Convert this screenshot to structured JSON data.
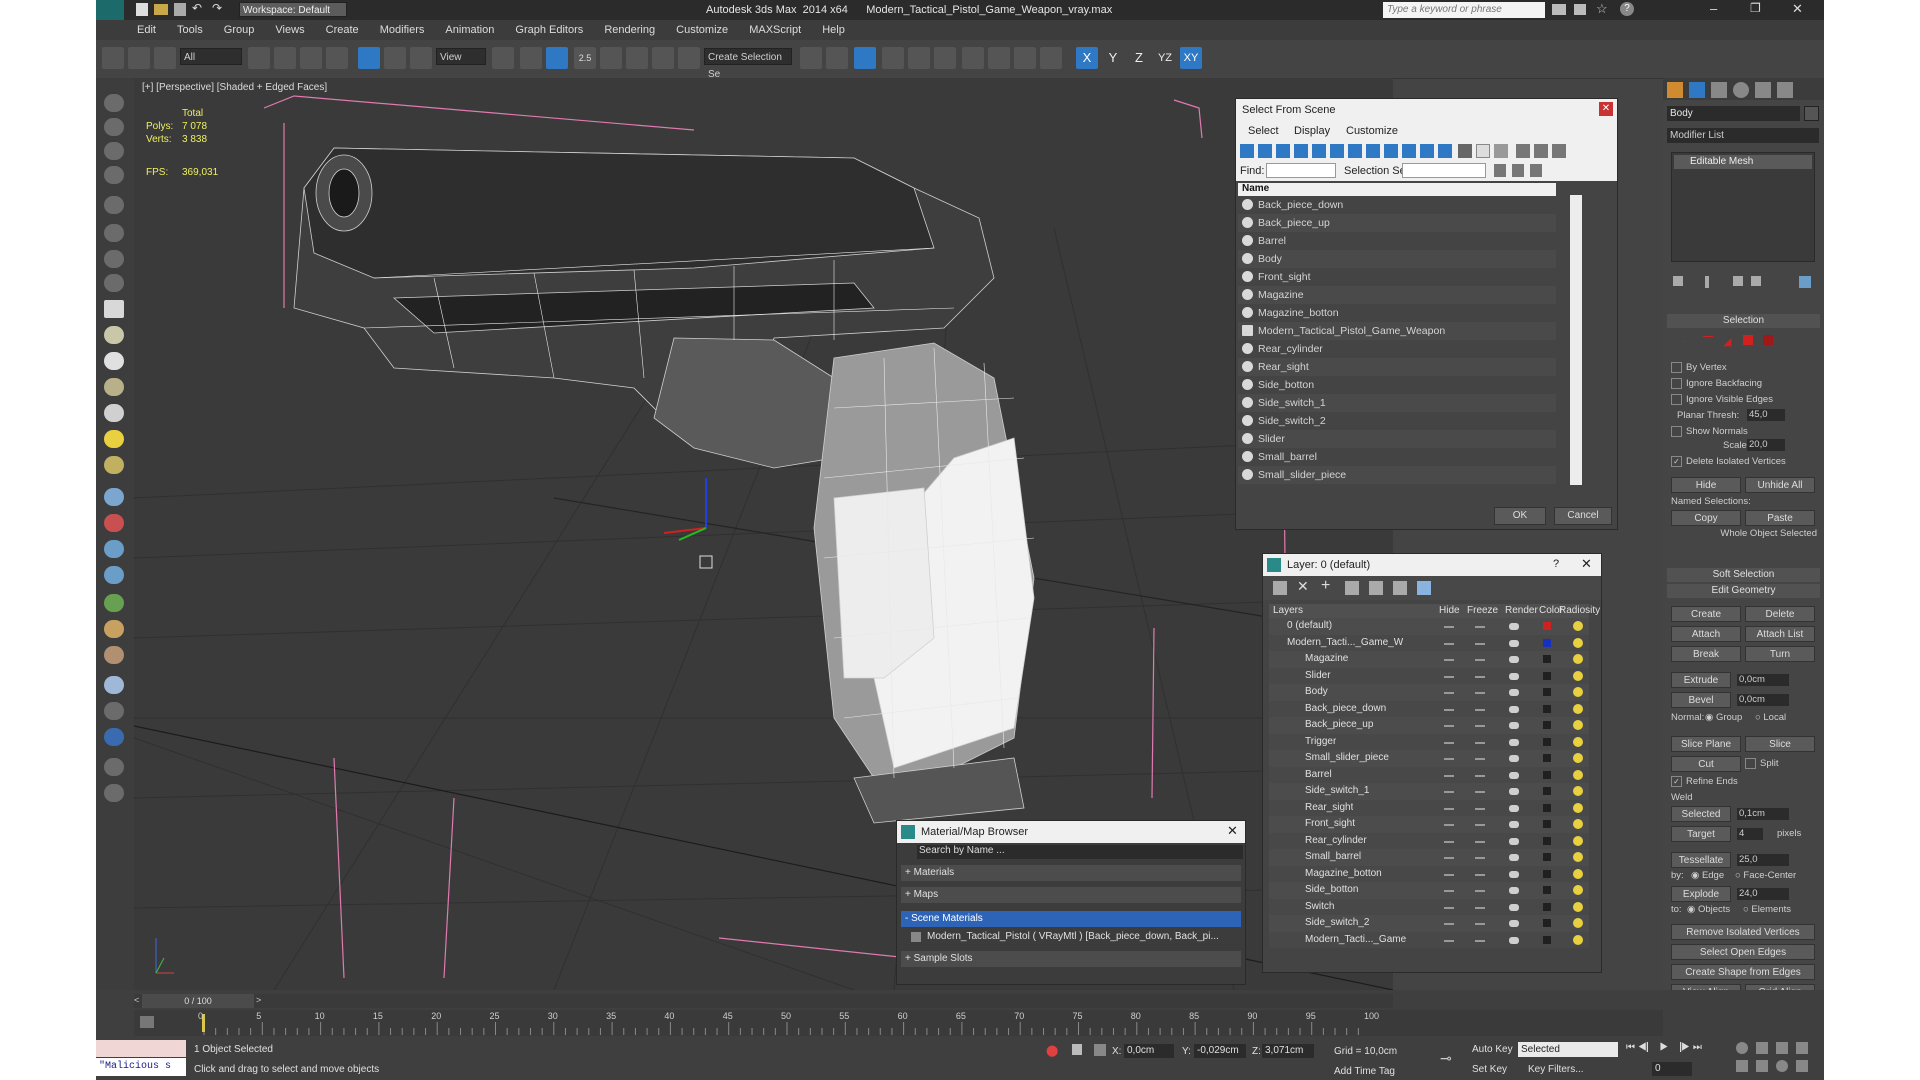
{
  "app": {
    "title": "Autodesk 3ds Max  2014 x64      Modern_Tactical_Pistol_Game_Weapon_vray.max",
    "workspace": "Workspace: Default",
    "search_placeholder": "Type a keyword or phrase"
  },
  "menu": [
    "Edit",
    "Tools",
    "Group",
    "Views",
    "Create",
    "Modifiers",
    "Animation",
    "Graph Editors",
    "Rendering",
    "Customize",
    "MAXScript",
    "Help"
  ],
  "toolbar": {
    "filter": "All",
    "ref_coord": "View",
    "selection_set": "Create Selection Se",
    "axis_labels": [
      "X",
      "Y",
      "Z",
      "YZ",
      "XY"
    ],
    "snap_value": "2.5"
  },
  "viewport": {
    "label": "[+] [Perspective] [Shaded + Edged Faces]",
    "stats_total": "Total",
    "polys_label": "Polys:",
    "polys_value": "7 078",
    "verts_label": "Verts:",
    "verts_value": "3 838",
    "fps_label": "FPS:",
    "fps_value": "369,031"
  },
  "select_from_scene": {
    "title": "Select From Scene",
    "menu": [
      "Select",
      "Display",
      "Customize"
    ],
    "find_label": "Find:",
    "selection_set_label": "Selection Set:",
    "column_name": "Name",
    "items": [
      "Back_piece_down",
      "Back_piece_up",
      "Barrel",
      "Body",
      "Front_sight",
      "Magazine",
      "Magazine_botton",
      "Modern_Tactical_Pistol_Game_Weapon",
      "Rear_cylinder",
      "Rear_sight",
      "Side_botton",
      "Side_switch_1",
      "Side_switch_2",
      "Slider",
      "Small_barrel",
      "Small_slider_piece"
    ],
    "ok": "OK",
    "cancel": "Cancel"
  },
  "layer_dialog": {
    "title": "Layer: 0 (default)",
    "help": "?",
    "columns": [
      "Layers",
      "Hide",
      "Freeze",
      "Render",
      "Color",
      "Radiosity"
    ],
    "rows": [
      {
        "name": "0 (default)",
        "color": "#d02020"
      },
      {
        "name": "Modern_Tacti..._Game_W",
        "color": "#1830c0"
      },
      {
        "name": "Magazine",
        "color": "#202020"
      },
      {
        "name": "Slider",
        "color": "#202020"
      },
      {
        "name": "Body",
        "color": "#202020"
      },
      {
        "name": "Back_piece_down",
        "color": "#202020"
      },
      {
        "name": "Back_piece_up",
        "color": "#202020"
      },
      {
        "name": "Trigger",
        "color": "#202020"
      },
      {
        "name": "Small_slider_piece",
        "color": "#202020"
      },
      {
        "name": "Barrel",
        "color": "#202020"
      },
      {
        "name": "Side_switch_1",
        "color": "#202020"
      },
      {
        "name": "Rear_sight",
        "color": "#202020"
      },
      {
        "name": "Front_sight",
        "color": "#202020"
      },
      {
        "name": "Rear_cylinder",
        "color": "#202020"
      },
      {
        "name": "Small_barrel",
        "color": "#202020"
      },
      {
        "name": "Magazine_botton",
        "color": "#202020"
      },
      {
        "name": "Side_botton",
        "color": "#202020"
      },
      {
        "name": "Switch",
        "color": "#202020"
      },
      {
        "name": "Side_switch_2",
        "color": "#202020"
      },
      {
        "name": "Modern_Tacti..._Game",
        "color": "#202020"
      }
    ]
  },
  "material_browser": {
    "title": "Material/Map Browser",
    "search": "Search by Name ...",
    "sections": [
      "+ Materials",
      "+ Maps",
      "- Scene Materials",
      "+ Sample Slots"
    ],
    "scene_material": "Modern_Tactical_Pistol  ( VRayMtl )  [Back_piece_down, Back_pi..."
  },
  "command_panel": {
    "object_name": "Body",
    "modifier_list": "Modifier List",
    "stack_item": "Editable Mesh",
    "selection_header": "Selection",
    "by_vertex": "By Vertex",
    "ignore_backfacing": "Ignore Backfacing",
    "ignore_visible_edges": "Ignore Visible Edges",
    "planar_thresh_label": "Planar Thresh:",
    "planar_thresh": "45,0",
    "show_normals": "Show Normals",
    "scale_label": "Scale:",
    "scale": "20,0",
    "delete_isolated": "Delete Isolated Vertices",
    "hide": "Hide",
    "unhide_all": "Unhide All",
    "named_selections": "Named Selections:",
    "copy": "Copy",
    "paste": "Paste",
    "whole_object": "Whole Object Selected",
    "soft_selection": "Soft Selection",
    "edit_geometry": "Edit Geometry",
    "create": "Create",
    "delete": "Delete",
    "attach": "Attach",
    "attach_list": "Attach List",
    "break": "Break",
    "turn": "Turn",
    "extrude": "Extrude",
    "extrude_val": "0,0cm",
    "bevel": "Bevel",
    "bevel_val": "0,0cm",
    "normal_label": "Normal:",
    "group": "Group",
    "local": "Local",
    "slice_plane": "Slice Plane",
    "slice": "Slice",
    "cut": "Cut",
    "split": "Split",
    "refine_ends": "Refine Ends",
    "weld": "Weld",
    "selected": "Selected",
    "selected_val": "0,1cm",
    "target": "Target",
    "target_val": "4",
    "pixels": "pixels",
    "tessellate": "Tessellate",
    "tess_val": "25,0",
    "by_label": "by:",
    "edge": "Edge",
    "face_center": "Face-Center",
    "explode": "Explode",
    "explode_val": "24,0",
    "to_label": "to:",
    "objects": "Objects",
    "elements": "Elements",
    "remove_isolated": "Remove Isolated Vertices",
    "select_open_edges": "Select Open Edges",
    "create_shape": "Create Shape from Edges",
    "view_align": "View Align",
    "grid_align": "Grid Align"
  },
  "timeline": {
    "frame": "0 / 100",
    "ticks": [
      "0",
      "5",
      "10",
      "15",
      "20",
      "25",
      "30",
      "35",
      "40",
      "45",
      "50",
      "55",
      "60",
      "65",
      "70",
      "75",
      "80",
      "85",
      "90",
      "95",
      "100"
    ]
  },
  "status": {
    "selected": "1 Object Selected",
    "prompt": "Click and drag to select and move objects",
    "script": "\"Malicious s",
    "x_label": "X:",
    "x": "0,0cm",
    "y_label": "Y:",
    "y": "-0,029cm",
    "z_label": "Z:",
    "z": "3,071cm",
    "grid": "Grid = 10,0cm",
    "auto_key": "Auto Key",
    "auto_key_mode": "Selected",
    "set_key": "Set Key",
    "key_filters": "Key Filters...",
    "add_time_tag": "Add Time Tag",
    "frame_field": "0"
  }
}
